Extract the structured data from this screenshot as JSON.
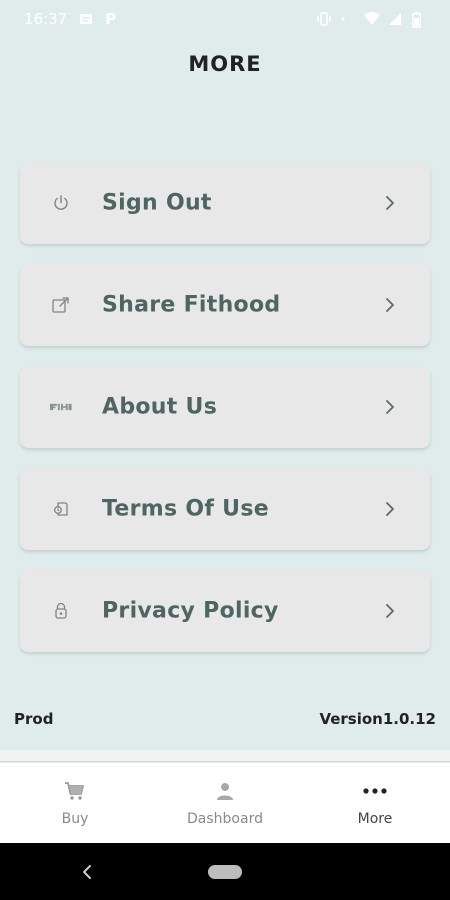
{
  "status_bar": {
    "time": "16:37",
    "indicator_letter": "P"
  },
  "header": {
    "title": "MORE"
  },
  "menu": {
    "items": [
      {
        "label": "Sign Out",
        "icon": "power-icon"
      },
      {
        "label": "Share Fithood",
        "icon": "share-icon"
      },
      {
        "label": "About Us",
        "icon": "fithood-logo-icon"
      },
      {
        "label": "Terms Of Use",
        "icon": "terms-icon"
      },
      {
        "label": "Privacy Policy",
        "icon": "lock-icon"
      }
    ]
  },
  "footer": {
    "environment": "Prod",
    "version": "Version1.0.12"
  },
  "bottom_nav": {
    "tabs": [
      {
        "label": "Buy",
        "icon": "cart-icon",
        "active": false
      },
      {
        "label": "Dashboard",
        "icon": "person-icon",
        "active": false
      },
      {
        "label": "More",
        "icon": "more-dots-icon",
        "active": true
      }
    ]
  },
  "colors": {
    "background": "#dfeceb",
    "card": "#e8e8e8",
    "label": "#4f6562"
  }
}
